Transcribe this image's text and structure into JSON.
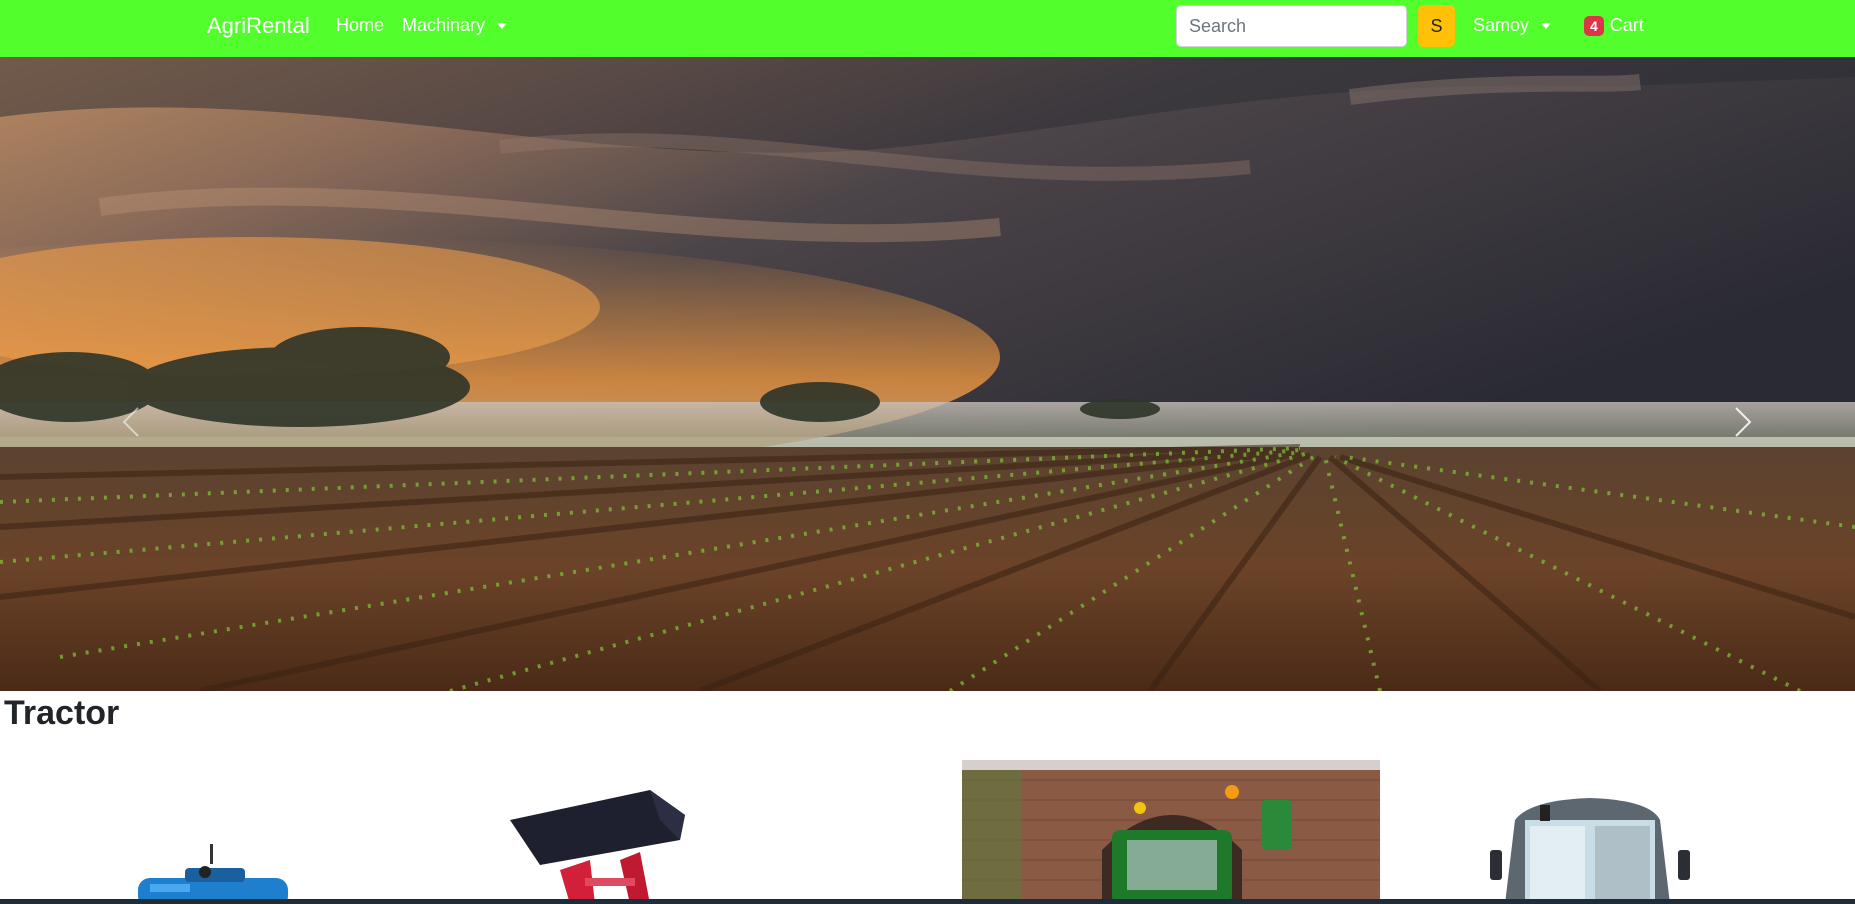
{
  "navbar": {
    "brand": "AgriRental",
    "home": "Home",
    "machinery": "Machinary",
    "search_placeholder": "Search",
    "search_button": "S",
    "user": "Samoy",
    "cart_count": "4",
    "cart_label": "Cart",
    "bg_color": "#52ff2c",
    "search_button_color": "#ffc107",
    "badge_color": "#dc3545"
  },
  "hero": {
    "prev_icon": "chevron-left-icon",
    "next_icon": "chevron-right-icon"
  },
  "section": {
    "title": "Tractor"
  }
}
